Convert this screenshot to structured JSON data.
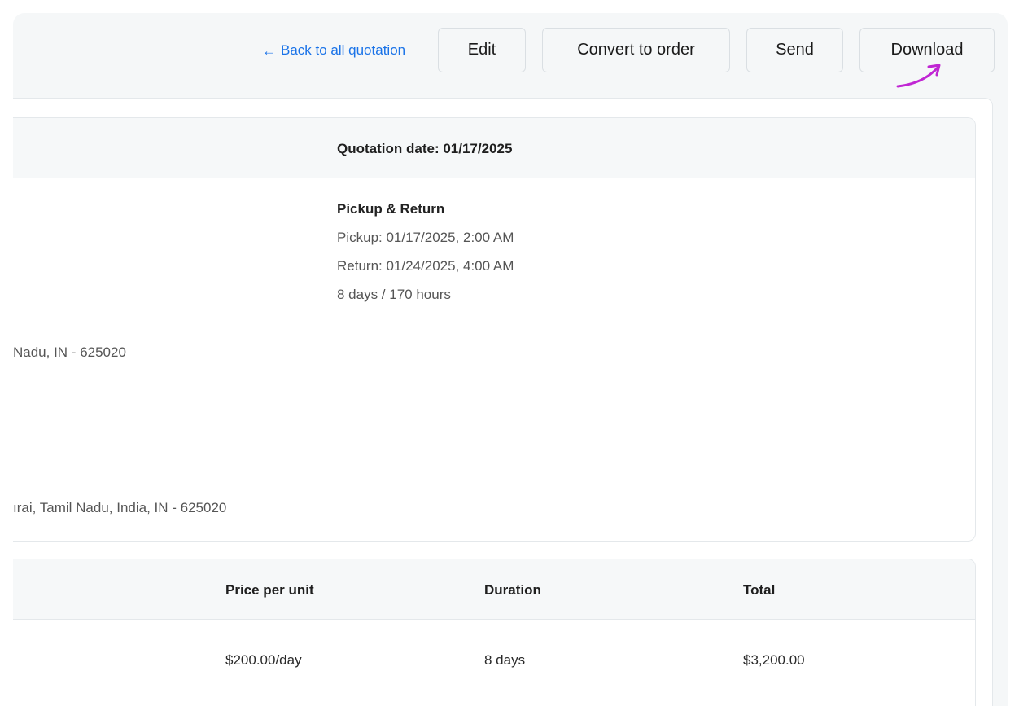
{
  "toolbar": {
    "back_link": "Back to all quotation",
    "edit_label": "Edit",
    "convert_label": "Convert to order",
    "send_label": "Send",
    "download_label": "Download"
  },
  "quotation": {
    "date_text": "Quotation date: 01/17/2025",
    "pickup_return_title": "Pickup & Return",
    "pickup": "Pickup: 01/17/2025, 2:00 AM",
    "return": "Return: 01/24/2025, 4:00 AM",
    "duration": "8 days / 170 hours",
    "address_1": "Nadu, IN - 625020",
    "address_2": "ırai, Tamil Nadu, India, IN - 625020"
  },
  "items_table": {
    "columns": [
      "Price per unit",
      "Duration",
      "Total"
    ],
    "rows": [
      [
        "$200.00/day",
        "8 days",
        "$3,200.00"
      ]
    ]
  },
  "colors": {
    "link": "#1a73e8",
    "annotation_arrow": "#c026d3"
  },
  "icons": {
    "back": "arrow-left-icon",
    "annotation": "curved-arrow-annotation"
  }
}
